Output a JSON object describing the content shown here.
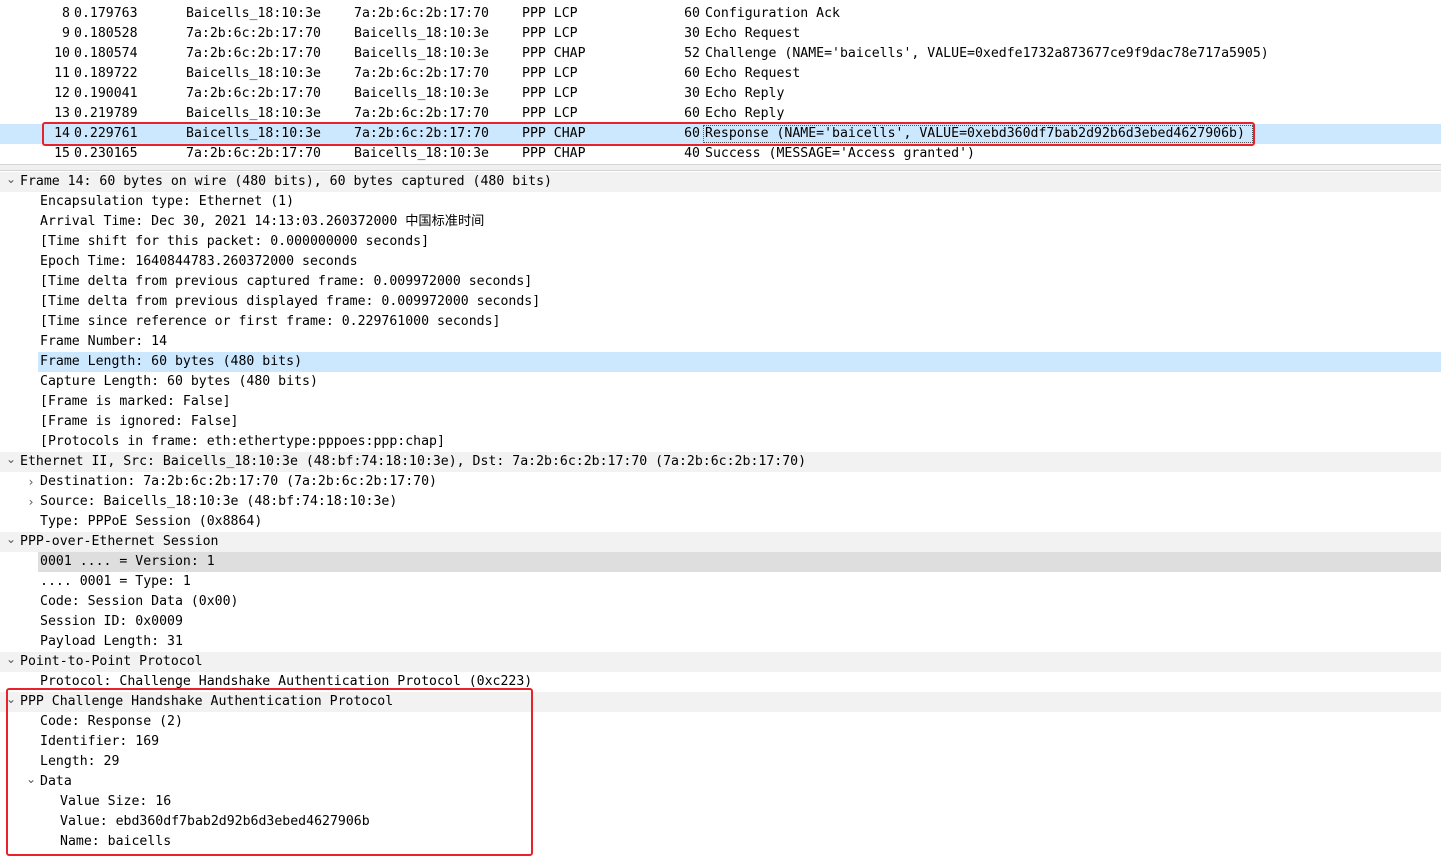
{
  "packets": [
    {
      "no": "8",
      "time": "0.179763",
      "src": "Baicells_18:10:3e",
      "dst": "7a:2b:6c:2b:17:70",
      "proto": "PPP LCP",
      "len": "60",
      "info": "Configuration Ack"
    },
    {
      "no": "9",
      "time": "0.180528",
      "src": "7a:2b:6c:2b:17:70",
      "dst": "Baicells_18:10:3e",
      "proto": "PPP LCP",
      "len": "30",
      "info": "Echo Request"
    },
    {
      "no": "10",
      "time": "0.180574",
      "src": "7a:2b:6c:2b:17:70",
      "dst": "Baicells_18:10:3e",
      "proto": "PPP CHAP",
      "len": "52",
      "info": "Challenge (NAME='baicells', VALUE=0xedfe1732a873677ce9f9dac78e717a5905)"
    },
    {
      "no": "11",
      "time": "0.189722",
      "src": "Baicells_18:10:3e",
      "dst": "7a:2b:6c:2b:17:70",
      "proto": "PPP LCP",
      "len": "60",
      "info": "Echo Request"
    },
    {
      "no": "12",
      "time": "0.190041",
      "src": "7a:2b:6c:2b:17:70",
      "dst": "Baicells_18:10:3e",
      "proto": "PPP LCP",
      "len": "30",
      "info": "Echo Reply"
    },
    {
      "no": "13",
      "time": "0.219789",
      "src": "Baicells_18:10:3e",
      "dst": "7a:2b:6c:2b:17:70",
      "proto": "PPP LCP",
      "len": "60",
      "info": "Echo Reply"
    },
    {
      "no": "14",
      "time": "0.229761",
      "src": "Baicells_18:10:3e",
      "dst": "7a:2b:6c:2b:17:70",
      "proto": "PPP CHAP",
      "len": "60",
      "info": "Response (NAME='baicells', VALUE=0xebd360df7bab2d92b6d3ebed4627906b)"
    },
    {
      "no": "15",
      "time": "0.230165",
      "src": "7a:2b:6c:2b:17:70",
      "dst": "Baicells_18:10:3e",
      "proto": "PPP CHAP",
      "len": "40",
      "info": "Success (MESSAGE='Access granted')"
    }
  ],
  "details": [
    {
      "text": "Frame 14: 60 bytes on wire (480 bits), 60 bytes captured (480 bits)",
      "chev": "down",
      "level": 0
    },
    {
      "text": "Encapsulation type: Ethernet (1)",
      "level": 1
    },
    {
      "text": "Arrival Time: Dec 30, 2021 14:13:03.260372000 中国标准时间",
      "level": 1
    },
    {
      "text": "[Time shift for this packet: 0.000000000 seconds]",
      "level": 1
    },
    {
      "text": "Epoch Time: 1640844783.260372000 seconds",
      "level": 1
    },
    {
      "text": "[Time delta from previous captured frame: 0.009972000 seconds]",
      "level": 1
    },
    {
      "text": "[Time delta from previous displayed frame: 0.009972000 seconds]",
      "level": 1
    },
    {
      "text": "[Time since reference or first frame: 0.229761000 seconds]",
      "level": 1
    },
    {
      "text": "Frame Number: 14",
      "level": 1
    },
    {
      "text": "Frame Length: 60 bytes (480 bits)",
      "level": 1,
      "state": "hl"
    },
    {
      "text": "Capture Length: 60 bytes (480 bits)",
      "level": 1
    },
    {
      "text": "[Frame is marked: False]",
      "level": 1
    },
    {
      "text": "[Frame is ignored: False]",
      "level": 1
    },
    {
      "text": "[Protocols in frame: eth:ethertype:pppoes:ppp:chap]",
      "level": 1
    },
    {
      "text": "Ethernet II, Src: Baicells_18:10:3e (48:bf:74:18:10:3e), Dst: 7a:2b:6c:2b:17:70 (7a:2b:6c:2b:17:70)",
      "chev": "down",
      "level": 0
    },
    {
      "text": "Destination: 7a:2b:6c:2b:17:70 (7a:2b:6c:2b:17:70)",
      "chev": "right",
      "level": 1
    },
    {
      "text": "Source: Baicells_18:10:3e (48:bf:74:18:10:3e)",
      "chev": "right",
      "level": 1
    },
    {
      "text": "Type: PPPoE Session (0x8864)",
      "level": 1
    },
    {
      "text": "PPP-over-Ethernet Session",
      "chev": "down",
      "level": 0
    },
    {
      "text": "0001 .... = Version: 1",
      "level": 1,
      "state": "gray"
    },
    {
      "text": ".... 0001 = Type: 1",
      "level": 1
    },
    {
      "text": "Code: Session Data (0x00)",
      "level": 1
    },
    {
      "text": "Session ID: 0x0009",
      "level": 1
    },
    {
      "text": "Payload Length: 31",
      "level": 1
    },
    {
      "text": "Point-to-Point Protocol",
      "chev": "down",
      "level": 0
    },
    {
      "text": "Protocol: Challenge Handshake Authentication Protocol (0xc223)",
      "level": 1
    },
    {
      "text": "PPP Challenge Handshake Authentication Protocol",
      "chev": "down",
      "level": 0
    },
    {
      "text": "Code: Response (2)",
      "level": 1
    },
    {
      "text": "Identifier: 169",
      "level": 1
    },
    {
      "text": "Length: 29",
      "level": 1
    },
    {
      "text": "Data",
      "chev": "down",
      "level": 1
    },
    {
      "text": "Value Size: 16",
      "level": 2
    },
    {
      "text": "Value: ebd360df7bab2d92b6d3ebed4627906b",
      "level": 2
    },
    {
      "text": "Name: baicells",
      "level": 2
    }
  ],
  "selected_packet": "14",
  "colors": {
    "selection": "#cce8ff",
    "annotation": "#e8222a"
  }
}
